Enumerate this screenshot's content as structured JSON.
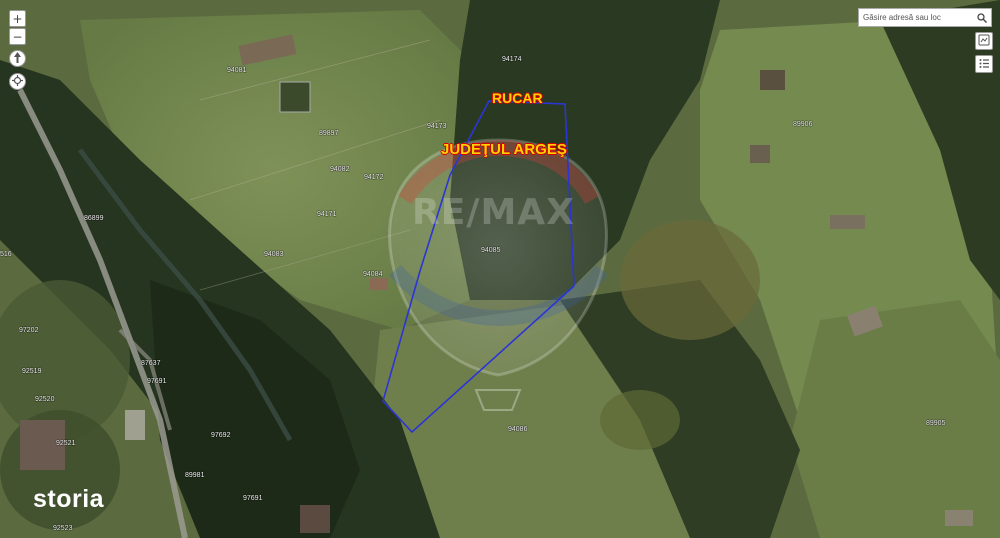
{
  "map": {
    "places": {
      "rucar": "RUCAR",
      "judet": "JUDEŢUL ARGEŞ"
    },
    "parcels": [
      {
        "id": "p94081",
        "text": "94081"
      },
      {
        "id": "p94174",
        "text": "94174"
      },
      {
        "id": "p94173",
        "text": "94173"
      },
      {
        "id": "p89897",
        "text": "89897"
      },
      {
        "id": "p94082",
        "text": "94082"
      },
      {
        "id": "p94172",
        "text": "94172"
      },
      {
        "id": "p94171",
        "text": "94171"
      },
      {
        "id": "p86899",
        "text": "86899"
      },
      {
        "id": "p94083",
        "text": "94083"
      },
      {
        "id": "p94084",
        "text": "94084"
      },
      {
        "id": "p94085",
        "text": "94085"
      },
      {
        "id": "p89906",
        "text": "89906"
      },
      {
        "id": "p516",
        "text": "516"
      },
      {
        "id": "p97202",
        "text": "97202"
      },
      {
        "id": "p87637",
        "text": "87637"
      },
      {
        "id": "p92519",
        "text": "92519"
      },
      {
        "id": "p97691",
        "text": "97691"
      },
      {
        "id": "p92520",
        "text": "92520"
      },
      {
        "id": "p92521",
        "text": "92521"
      },
      {
        "id": "p97692",
        "text": "97692"
      },
      {
        "id": "p94086",
        "text": "94086"
      },
      {
        "id": "p89905",
        "text": "89905"
      },
      {
        "id": "p89981",
        "text": "89981"
      },
      {
        "id": "p97691b",
        "text": "97691"
      },
      {
        "id": "p92523",
        "text": "92523"
      }
    ],
    "watermark": "RE/MAX",
    "colors": {
      "boundary": "#2b35d6",
      "place_fill": "#ffd200",
      "place_outline": "#d40000"
    }
  },
  "controls": {
    "zoom_in": "+",
    "zoom_out": "−",
    "north_icon": "north-arrow-icon",
    "locate_icon": "locate-icon",
    "layers_icon": "layers-icon",
    "legend_icon": "legend-list-icon"
  },
  "search": {
    "placeholder": "Găsire adresă sau loc",
    "icon": "search-icon"
  },
  "branding": {
    "storia": "storia"
  }
}
